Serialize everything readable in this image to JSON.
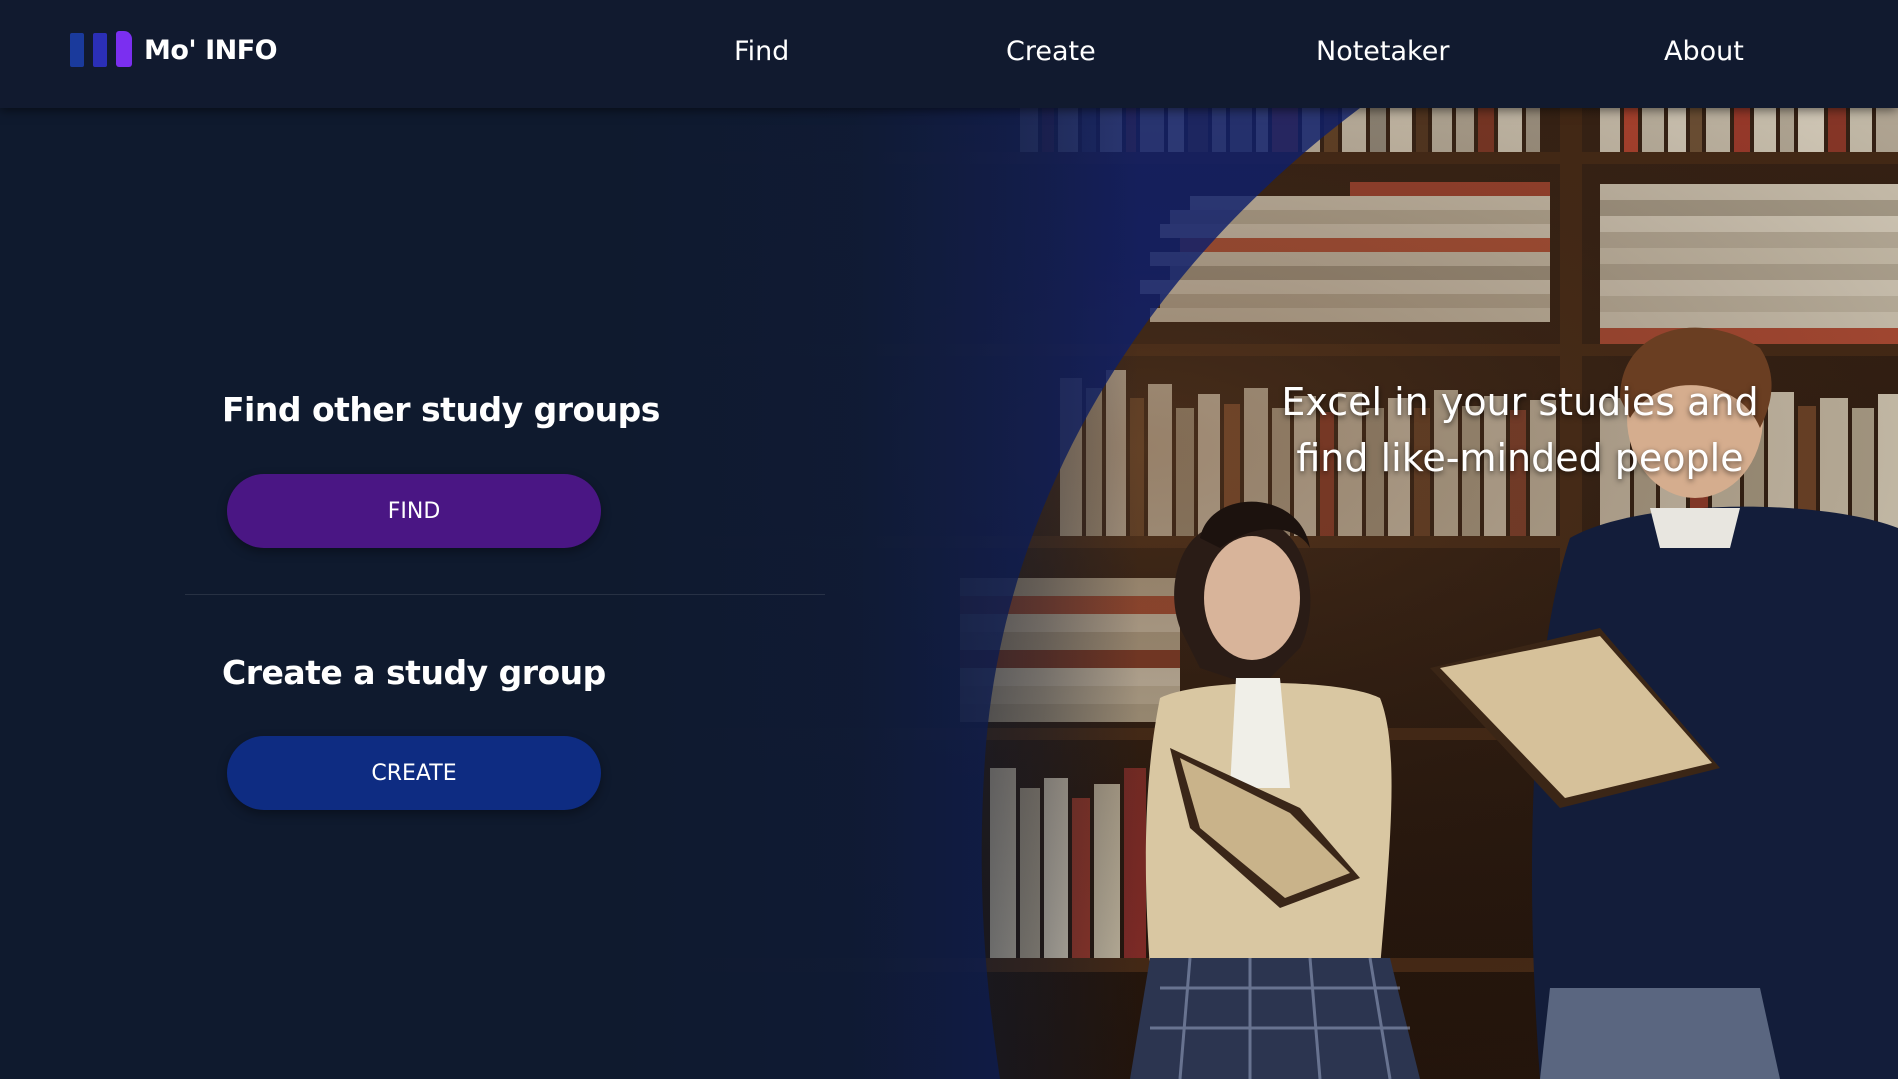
{
  "brand": {
    "name": "Mo' INFO",
    "logo_icon": "three-bars-logo-icon"
  },
  "nav": {
    "items": [
      {
        "label": "Find"
      },
      {
        "label": "Create"
      },
      {
        "label": "Notetaker"
      },
      {
        "label": "About"
      }
    ]
  },
  "hero": {
    "tagline_line1": "Excel in your studies and",
    "tagline_line2": "find like-minded people",
    "background_image": "library-students-reading-photo"
  },
  "find_section": {
    "title": "Find other study groups",
    "button_label": "FIND"
  },
  "create_section": {
    "title": "Create a study group",
    "button_label": "CREATE"
  },
  "colors": {
    "page_background": "#0f1a2e",
    "navbar_background": "#111a2f",
    "find_button": "#4a1684",
    "create_button": "#0e2c82",
    "blue_arc_overlay": "#0d1f6b",
    "logo_purple": "#7b2ff0",
    "logo_blue": "#1a3a9c"
  }
}
